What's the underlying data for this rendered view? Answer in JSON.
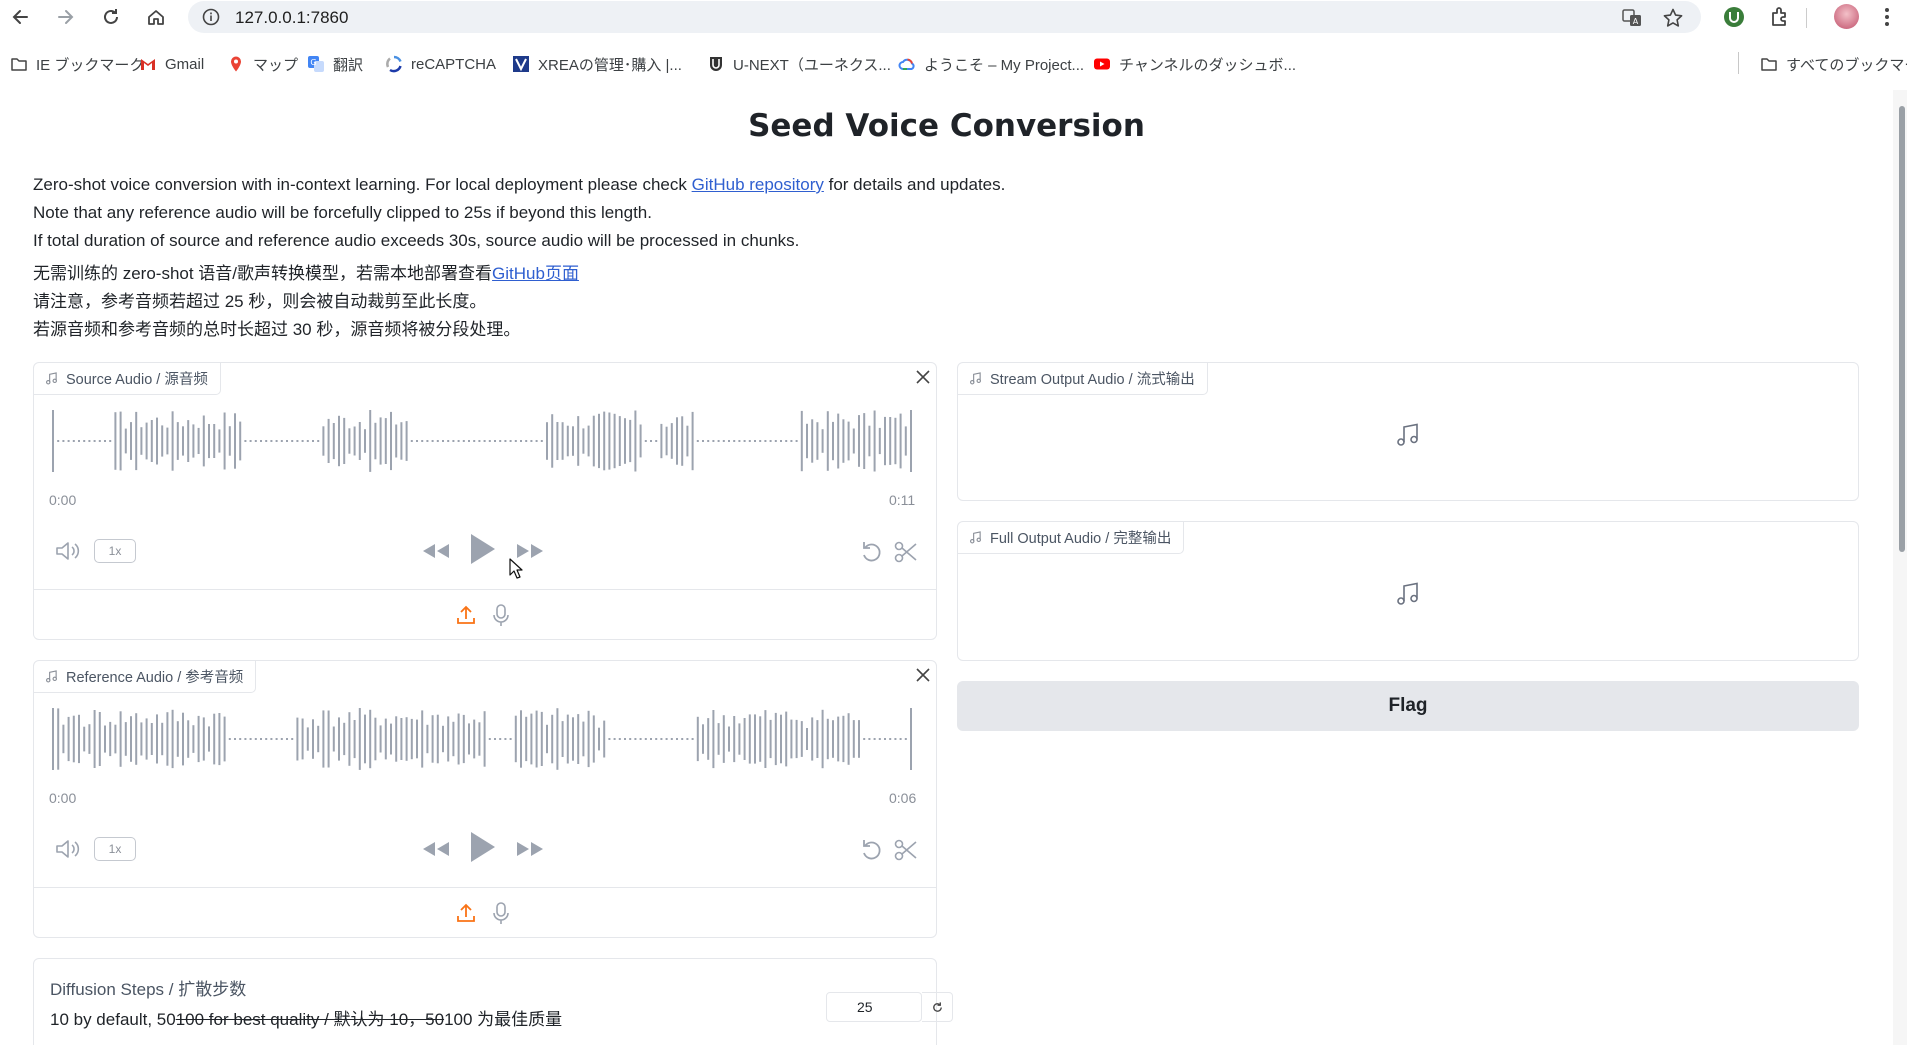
{
  "browser": {
    "url": "127.0.0.1:7860",
    "bookmarks": [
      {
        "label": "IE ブックマーク",
        "icon": "folder-icon"
      },
      {
        "label": "Gmail",
        "icon": "gmail-icon"
      },
      {
        "label": "マップ",
        "icon": "maps-icon"
      },
      {
        "label": "翻訳",
        "icon": "translate-icon"
      },
      {
        "label": "reCAPTCHA",
        "icon": "recaptcha-icon"
      },
      {
        "label": "XREAの管理･購入 |...",
        "icon": "xrea-icon"
      },
      {
        "label": "U-NEXT（ユーネクス...",
        "icon": "unext-icon"
      },
      {
        "label": "ようこそ – My Project...",
        "icon": "gcloud-icon"
      },
      {
        "label": "チャンネルのダッシュボ...",
        "icon": "youtube-icon"
      }
    ],
    "all_bookmarks": "すべてのブックマーク"
  },
  "page": {
    "title": "Seed Voice Conversion",
    "desc_line1_pre": "Zero-shot voice conversion with in-context learning. For local deployment please check ",
    "desc_line1_link": "GitHub repository",
    "desc_line1_post": " for details and updates.",
    "desc_line2": "Note that any reference audio will be forcefully clipped to 25s if beyond this length.",
    "desc_line3": "If total duration of source and reference audio exceeds 30s, source audio will be processed in chunks.",
    "desc_line4_pre": "无需训练的 zero-shot 语音/歌声转换模型，若需本地部署查看",
    "desc_line4_link": "GitHub页面",
    "desc_line5": "请注意，参考音频若超过 25 秒，则会被自动裁剪至此长度。",
    "desc_line6": "若源音频和参考音频的总时长超过 30 秒，源音频将被分段处理。"
  },
  "source_audio": {
    "label": "Source Audio / 源音频",
    "time_start": "0:00",
    "time_end": "0:11",
    "rate": "1x"
  },
  "reference_audio": {
    "label": "Reference Audio / 参考音频",
    "time_start": "0:00",
    "time_end": "0:06",
    "rate": "1x"
  },
  "stream_output": {
    "label": "Stream Output Audio / 流式输出"
  },
  "full_output": {
    "label": "Full Output Audio / 完整输出"
  },
  "flag": {
    "label": "Flag"
  },
  "diffusion": {
    "title": "Diffusion Steps / 扩散步数",
    "info_a": "10 by default, 50",
    "info_strike": "100 for best quality / 默认为 10，50",
    "info_b": "100 为最佳质量",
    "value": "25"
  },
  "colors": {
    "accent": "#f97316",
    "link": "#2f5fd0",
    "wave": "#9ca3af"
  }
}
